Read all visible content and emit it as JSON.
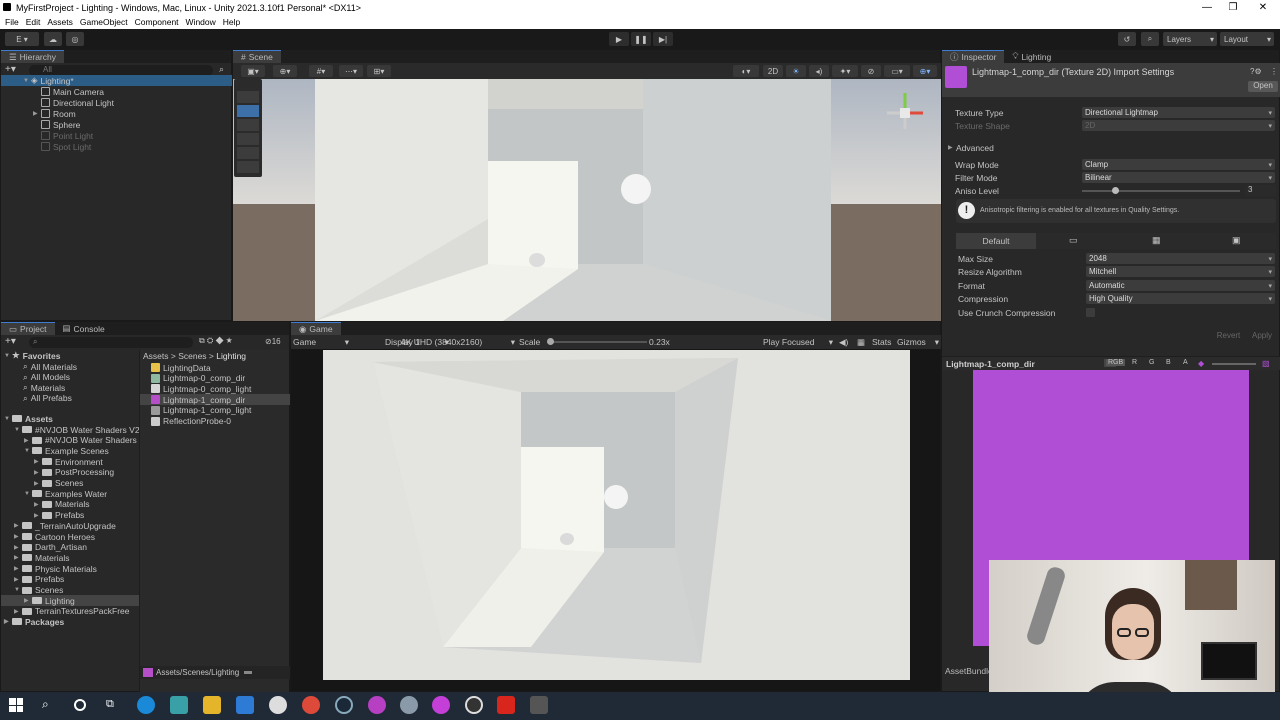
{
  "window": {
    "title": "MyFirstProject - Lighting - Windows, Mac, Linux - Unity 2021.3.10f1 Personal* <DX11>",
    "controls": [
      "—",
      "❐",
      "✕"
    ]
  },
  "menu": [
    "File",
    "Edit",
    "Assets",
    "GameObject",
    "Component",
    "Window",
    "Help"
  ],
  "toolbar": {
    "account": "E ▾",
    "layers": "Layers",
    "layout": "Layout"
  },
  "hierarchy": {
    "tab": "Hierarchy",
    "search_placeholder": "All",
    "scene": "Lighting*",
    "items": [
      {
        "label": "Main Camera",
        "enabled": true
      },
      {
        "label": "Directional Light",
        "enabled": true
      },
      {
        "label": "Room",
        "enabled": true
      },
      {
        "label": "Sphere",
        "enabled": true
      },
      {
        "label": "Point Light",
        "enabled": false
      },
      {
        "label": "Spot Light",
        "enabled": false
      }
    ]
  },
  "scene_view": {
    "tab": "Scene",
    "mode_2d": "2D"
  },
  "game_view": {
    "tab": "Game",
    "view": "Game",
    "display": "Display 1",
    "resolution": "4K UHD (3840x2160)",
    "scale_label": "Scale",
    "scale_value": "0.23x",
    "scale_level": 0.0,
    "play_mode": "Play Focused",
    "stats": "Stats",
    "gizmos": "Gizmos"
  },
  "project": {
    "tabs": [
      "Project",
      "Console"
    ],
    "count": "16",
    "breadcrumb": [
      "Assets",
      "Scenes",
      "Lighting"
    ],
    "favorites_label": "Favorites",
    "favorites": [
      "All Materials",
      "All Models",
      "Materials",
      "All Prefabs"
    ],
    "assets_label": "Assets",
    "tree": [
      {
        "label": "#NVJOB Water Shaders V2",
        "indent": 1
      },
      {
        "label": "#NVJOB Water Shaders V",
        "indent": 2
      },
      {
        "label": "Example Scenes",
        "indent": 2
      },
      {
        "label": "Environment",
        "indent": 3
      },
      {
        "label": "PostProcessing",
        "indent": 3
      },
      {
        "label": "Scenes",
        "indent": 3
      },
      {
        "label": "Examples Water",
        "indent": 2
      },
      {
        "label": "Materials",
        "indent": 3
      },
      {
        "label": "Prefabs",
        "indent": 3
      },
      {
        "label": "_TerrainAutoUpgrade",
        "indent": 1
      },
      {
        "label": "Cartoon Heroes",
        "indent": 1
      },
      {
        "label": "Darth_Artisan",
        "indent": 1
      },
      {
        "label": "Materials",
        "indent": 1
      },
      {
        "label": "Physic Materials",
        "indent": 1
      },
      {
        "label": "Prefabs",
        "indent": 1
      },
      {
        "label": "Scenes",
        "indent": 1
      },
      {
        "label": "Lighting",
        "indent": 2
      },
      {
        "label": "TerrainTexturesPackFree",
        "indent": 1
      }
    ],
    "packages_label": "Packages",
    "files": [
      {
        "label": "LightingData",
        "color": "#e8c14a"
      },
      {
        "label": "Lightmap-0_comp_dir",
        "color": "#8fb8a0"
      },
      {
        "label": "Lightmap-0_comp_light",
        "color": "#d6d6d6"
      },
      {
        "label": "Lightmap-1_comp_dir",
        "color": "#b44fc8"
      },
      {
        "label": "Lightmap-1_comp_light",
        "color": "#9a9a9a"
      },
      {
        "label": "ReflectionProbe-0",
        "color": "#cccccc"
      }
    ],
    "footer_path": "Assets/Scenes/Lighting"
  },
  "inspector": {
    "tabs": [
      "Inspector",
      "Lighting"
    ],
    "title": "Lightmap-1_comp_dir (Texture 2D) Import Settings",
    "open": "Open",
    "texture_type_label": "Texture Type",
    "texture_type": "Directional Lightmap",
    "texture_shape_label": "Texture Shape",
    "texture_shape": "2D",
    "advanced": "Advanced",
    "wrap_mode_label": "Wrap Mode",
    "wrap_mode": "Clamp",
    "filter_mode_label": "Filter Mode",
    "filter_mode": "Bilinear",
    "aniso_label": "Aniso Level",
    "aniso_value": "3",
    "aniso_fraction": 0.19,
    "info": "Anisotropic filtering is enabled for all textures in Quality Settings.",
    "platform_default": "Default",
    "max_size_label": "Max Size",
    "max_size": "2048",
    "resize_label": "Resize Algorithm",
    "resize": "Mitchell",
    "format_label": "Format",
    "format": "Automatic",
    "compression_label": "Compression",
    "compression": "High Quality",
    "crunch_label": "Use Crunch Compression",
    "revert": "Revert",
    "apply": "Apply",
    "preview_title": "Lightmap-1_comp_dir",
    "channels": [
      "RGB",
      "R",
      "G",
      "B",
      "A"
    ],
    "preview_color": "#b04fd6",
    "assetbundle": "AssetBundle"
  }
}
